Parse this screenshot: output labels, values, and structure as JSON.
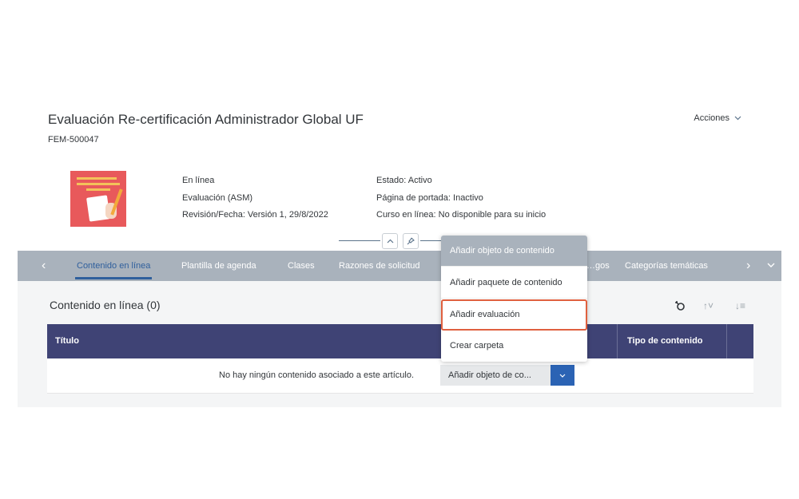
{
  "header": {
    "title": "Evaluación Re-certificación Administrador Global UF",
    "code": "FEM-500047",
    "actions_label": "Acciones"
  },
  "meta": {
    "col1": [
      "En línea",
      "Evaluación (ASM)",
      "Revisión/Fecha: Versión 1, 29/8/2022"
    ],
    "col2": [
      "Estado: Activo",
      "Página de portada: Inactivo",
      "Curso en línea: No disponible para su inicio"
    ]
  },
  "tabs": [
    {
      "label": "Contenido en línea",
      "active": true
    },
    {
      "label": "Plantilla de agenda",
      "active": false
    },
    {
      "label": "Clases",
      "active": false
    },
    {
      "label": "Razones de solicitud",
      "active": false
    },
    {
      "label": "…gos",
      "active": false
    },
    {
      "label": "Categorías temáticas",
      "active": false
    }
  ],
  "section": {
    "title": "Contenido en línea (0)"
  },
  "table": {
    "columns": [
      "Título",
      "Tipo de contenido"
    ],
    "empty_message": "No hay ningún contenido asociado a este artículo."
  },
  "add_select": {
    "value": "Añadir objeto de co..."
  },
  "dropdown": {
    "items": [
      "Añadir objeto de contenido",
      "Añadir paquete de contenido",
      "Añadir evaluación",
      "Crear carpeta"
    ],
    "highlighted_index": 2
  },
  "colors": {
    "table_header": "#3f4375",
    "tab_bar": "#a9b2bc",
    "accent_blue": "#2b63b4",
    "highlight_outline": "#e0603f",
    "thumbnail": "#e8595b"
  },
  "icons": {
    "tab_prev": "chevron-left",
    "tab_next": "chevron-right",
    "tab_overflow": "chevron-down",
    "collapse": "chevron-up",
    "pin": "pin",
    "actions_caret": "chevron-down",
    "select_caret": "chevron-down",
    "link": "link-icon",
    "sort": "sort-icon",
    "reorder": "reorder-icon"
  }
}
